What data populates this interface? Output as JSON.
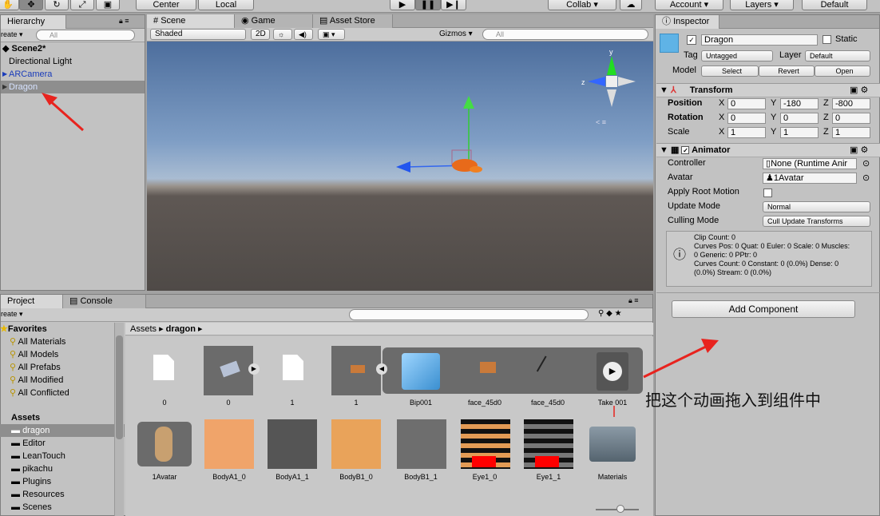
{
  "toolbar": {
    "center_label": "Center",
    "local_label": "Local",
    "collab_label": "Collab ▾",
    "account_label": "Account ▾",
    "layers_label": "Layers ▾",
    "layout_label": "Default"
  },
  "hierarchy": {
    "tab": "Hierarchy",
    "create": "reate ▾",
    "search_placeholder": "All",
    "scene": "Scene2*",
    "items": [
      "Directional Light",
      "ARCamera",
      "Dragon"
    ]
  },
  "scene": {
    "tab_scene": "Scene",
    "tab_game": "Game",
    "tab_store": "Asset Store",
    "shaded": "Shaded",
    "mode2d": "2D",
    "gizmos": "Gizmos ▾",
    "search_placeholder": "All"
  },
  "inspector": {
    "tab": "Inspector",
    "name": "Dragon",
    "static_label": "Static",
    "tag_label": "Tag",
    "tag_value": "Untagged",
    "layer_label": "Layer",
    "layer_value": "Default",
    "model_label": "Model",
    "select_btn": "Select",
    "revert_btn": "Revert",
    "open_btn": "Open",
    "transform": {
      "title": "Transform",
      "position": "Position",
      "rotation": "Rotation",
      "scale": "Scale",
      "pos": [
        "0",
        "-180",
        "-800"
      ],
      "rot": [
        "0",
        "0",
        "0"
      ],
      "scl": [
        "1",
        "1",
        "1"
      ]
    },
    "animator": {
      "title": "Animator",
      "controller_label": "Controller",
      "controller_value": "None (Runtime Anir",
      "avatar_label": "Avatar",
      "avatar_value": "1Avatar",
      "root_motion_label": "Apply Root Motion",
      "update_mode_label": "Update Mode",
      "update_mode_value": "Normal",
      "culling_label": "Culling Mode",
      "culling_value": "Cull Update Transforms",
      "info": [
        "Clip Count: 0",
        "Curves Pos: 0 Quat: 0 Euler: 0 Scale: 0 Muscles:",
        "0 Generic: 0 PPtr: 0",
        "Curves Count: 0 Constant: 0 (0.0%) Dense: 0",
        "(0.0%) Stream: 0 (0.0%)"
      ]
    },
    "add_component": "Add Component"
  },
  "project": {
    "tab_project": "Project",
    "tab_console": "Console",
    "create": "reate ▾",
    "breadcrumb_root": "Assets",
    "breadcrumb_folder": "dragon",
    "favorites_title": "Favorites",
    "favorites": [
      "All Materials",
      "All Models",
      "All Prefabs",
      "All Modified",
      "All Conflicted"
    ],
    "assets_title": "Assets",
    "folders": [
      "dragon",
      "Editor",
      "LeanTouch",
      "pikachu",
      "Plugins",
      "Resources",
      "Scenes"
    ],
    "row1": [
      "0",
      "0",
      "1",
      "1",
      "Bip001",
      "face_45d0",
      "face_45d0",
      "Take 001"
    ],
    "row2": [
      "1Avatar",
      "BodyA1_0",
      "BodyA1_1",
      "BodyB1_0",
      "BodyB1_1",
      "Eye1_0",
      "Eye1_1",
      "Materials"
    ]
  },
  "annotation": "把这个动画拖入到组件中",
  "colors": {
    "accent_red": "#e8231e",
    "selection": "#8e8e8e"
  }
}
